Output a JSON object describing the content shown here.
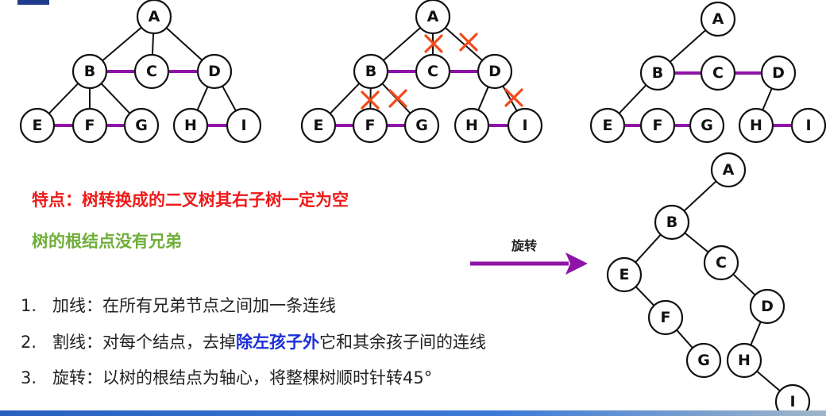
{
  "trees": {
    "tree1": {
      "nodes": [
        "A",
        "B",
        "C",
        "D",
        "E",
        "F",
        "G",
        "H",
        "I"
      ],
      "tree_edges": [
        [
          "A",
          "B"
        ],
        [
          "A",
          "C"
        ],
        [
          "A",
          "D"
        ],
        [
          "B",
          "E"
        ],
        [
          "B",
          "F"
        ],
        [
          "B",
          "G"
        ],
        [
          "D",
          "H"
        ],
        [
          "D",
          "I"
        ]
      ],
      "sibling_edges": [
        [
          "B",
          "C"
        ],
        [
          "C",
          "D"
        ],
        [
          "E",
          "F"
        ],
        [
          "F",
          "G"
        ],
        [
          "H",
          "I"
        ]
      ]
    },
    "tree2": {
      "nodes": [
        "A",
        "B",
        "C",
        "D",
        "E",
        "F",
        "G",
        "H",
        "I"
      ],
      "tree_edges": [
        [
          "A",
          "B"
        ],
        [
          "A",
          "C"
        ],
        [
          "A",
          "D"
        ],
        [
          "B",
          "E"
        ],
        [
          "B",
          "F"
        ],
        [
          "B",
          "G"
        ],
        [
          "D",
          "H"
        ],
        [
          "D",
          "I"
        ]
      ],
      "sibling_edges": [
        [
          "B",
          "C"
        ],
        [
          "C",
          "D"
        ],
        [
          "E",
          "F"
        ],
        [
          "F",
          "G"
        ],
        [
          "H",
          "I"
        ]
      ],
      "cut_edges": [
        [
          "A",
          "C"
        ],
        [
          "A",
          "D"
        ],
        [
          "B",
          "F"
        ],
        [
          "B",
          "G"
        ],
        [
          "D",
          "I"
        ]
      ]
    },
    "tree3": {
      "nodes": [
        "A",
        "B",
        "C",
        "D",
        "E",
        "F",
        "G",
        "H",
        "I"
      ],
      "tree_edges": [
        [
          "A",
          "B"
        ],
        [
          "B",
          "E"
        ],
        [
          "D",
          "H"
        ]
      ],
      "sibling_edges": [
        [
          "B",
          "C"
        ],
        [
          "C",
          "D"
        ],
        [
          "E",
          "F"
        ],
        [
          "F",
          "G"
        ],
        [
          "H",
          "I"
        ]
      ]
    },
    "tree4": {
      "nodes": [
        "A",
        "B",
        "C",
        "D",
        "E",
        "F",
        "G",
        "H",
        "I"
      ],
      "tree_edges": [
        [
          "A",
          "B"
        ],
        [
          "B",
          "E"
        ],
        [
          "B",
          "C"
        ],
        [
          "E",
          "F"
        ],
        [
          "F",
          "G"
        ],
        [
          "C",
          "D"
        ],
        [
          "D",
          "H"
        ],
        [
          "H",
          "I"
        ]
      ]
    }
  },
  "text": {
    "feature": "特点：树转换成的二叉树其右子树一定为空",
    "root_note": "树的根结点没有兄弟",
    "rotate_label": "旋转",
    "steps": [
      {
        "num": "1.",
        "text": "加线：在所有兄弟节点之间加一条连线"
      },
      {
        "num": "2.",
        "before": "割线：对每个结点，去掉",
        "emph": "除左孩子外",
        "after": "它和其余孩子间的连线"
      },
      {
        "num": "3.",
        "text": "旋转：以树的根结点为轴心，将整棵树顺时针转45°"
      }
    ]
  },
  "colors": {
    "sibling_line": "#8e14a8",
    "cut_mark": "#f24a1c",
    "feature_text": "#ee1a1a",
    "root_note_text": "#6fae3a",
    "emphasis_text": "#1c2fd6",
    "arrow": "#8e14a8"
  }
}
